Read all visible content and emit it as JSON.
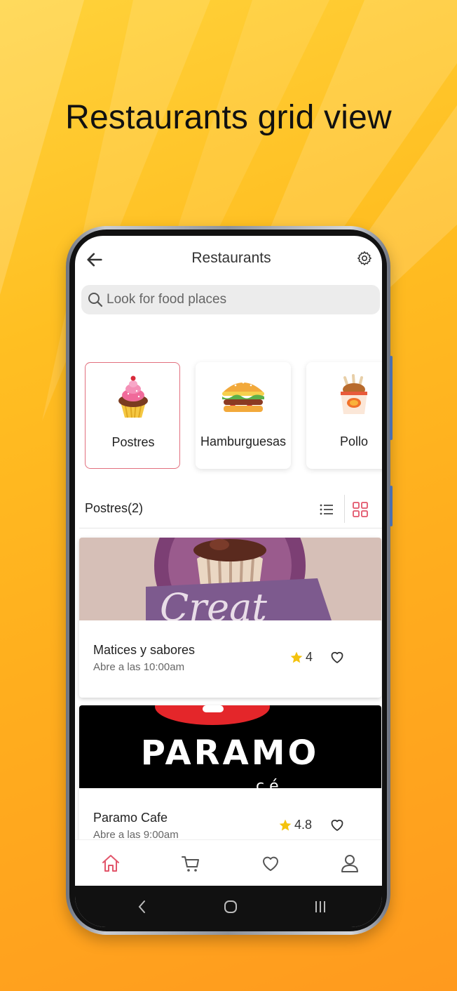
{
  "promo": {
    "title": "Restaurants grid view"
  },
  "header": {
    "title": "Restaurants",
    "back_icon": "arrow-left-icon",
    "settings_icon": "gear-icon"
  },
  "search": {
    "placeholder": "Look for food places",
    "value": ""
  },
  "categories": [
    {
      "label": "Postres",
      "icon": "cupcake-icon",
      "selected": true
    },
    {
      "label": "Hamburguesas",
      "icon": "burger-icon",
      "selected": false
    },
    {
      "label": "Pollo",
      "icon": "fried-chicken-icon",
      "selected": false
    }
  ],
  "section": {
    "title": "Postres(2)",
    "view_modes": [
      "list",
      "grid"
    ],
    "active_view": "grid"
  },
  "restaurants": [
    {
      "name": "Matices y sabores",
      "hours": "Abre a las 10:00am",
      "rating": "4",
      "banner_text": "Creat"
    },
    {
      "name": "Paramo Cafe",
      "hours": "Abre a las 9:00am",
      "rating": "4.8",
      "banner_text": "PARAMO"
    }
  ],
  "bottom_nav": [
    {
      "icon": "home-icon",
      "active": true
    },
    {
      "icon": "cart-icon",
      "active": false
    },
    {
      "icon": "heart-icon",
      "active": false
    },
    {
      "icon": "profile-icon",
      "active": false
    }
  ],
  "colors": {
    "accent": "#e2566b",
    "star": "#f4c20d",
    "background_gradient_start": "#ffd23a",
    "background_gradient_end": "#ff9a1e"
  }
}
